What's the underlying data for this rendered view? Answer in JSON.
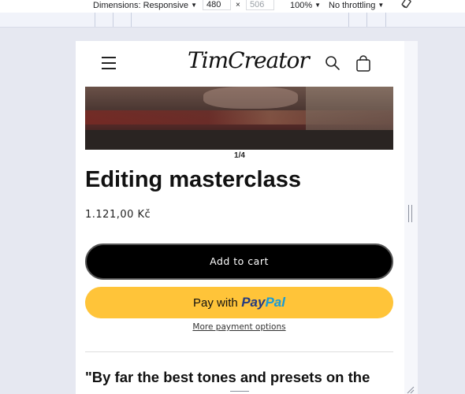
{
  "devtools": {
    "dimensions_label": "Dimensions: Responsive",
    "width_value": "480",
    "times_sign": "×",
    "height_placeholder": "506",
    "zoom_label": "100%",
    "throttling_label": "No throttling",
    "caret": "▼",
    "rotate_icon": "rotate-icon"
  },
  "store": {
    "logo_text": "TimCreator",
    "menu_icon": "hamburger-menu-icon",
    "search_icon": "search-icon",
    "cart_icon": "cart-icon"
  },
  "product": {
    "slide_counter": "1/4",
    "title": "Editing masterclass",
    "price": "1.121,00 Kč",
    "add_to_cart_label": "Add to cart",
    "paypal": {
      "pay_with": "Pay with",
      "brand_pay": "Pay",
      "brand_pal": "Pal",
      "brand_pay_color": "#253b80",
      "brand_pal_color": "#179bd7",
      "button_color": "#ffc439"
    },
    "more_payment_options": "More payment options",
    "quote_preview": "\"By far the best tones and presets on the"
  }
}
